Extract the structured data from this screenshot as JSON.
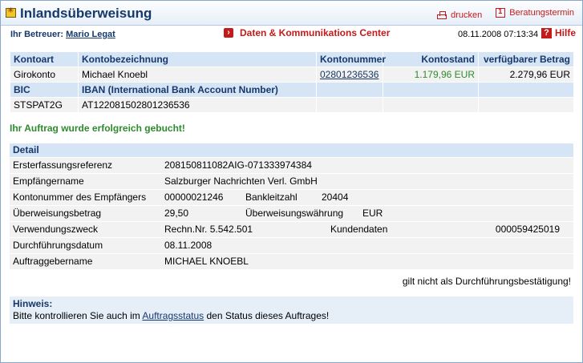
{
  "header": {
    "title": "Inlandsüberweisung",
    "print_label": "drucken",
    "appointment_label": "Beratungstermin"
  },
  "info": {
    "advisor_label": "Ihr Betreuer:",
    "advisor_name": "Mario Legat",
    "center_label": "Daten & Kommunikations Center",
    "datetime": "08.11.2008 07:13:34",
    "help_label": "Hilfe"
  },
  "account": {
    "headers": {
      "kontoart": "Kontoart",
      "bezeichnung": "Kontobezeichnung",
      "nummer": "Kontonummer",
      "stand": "Kontostand",
      "verfuegbar": "verfügbarer Betrag"
    },
    "row": {
      "kontoart": "Girokonto",
      "bezeichnung": "Michael Knoebl",
      "nummer": "02801236536",
      "stand": "1.179,96 EUR",
      "verfuegbar": "2.279,96 EUR"
    },
    "headers2": {
      "bic": "BIC",
      "iban": "IBAN (International Bank Account Number)"
    },
    "row2": {
      "bic": "STSPAT2G",
      "iban": "AT122081502801236536"
    }
  },
  "success_message": "Ihr Auftrag wurde erfolgreich gebucht!",
  "detail": {
    "title": "Detail",
    "ersterfassung_label": "Ersterfassungsreferenz",
    "ersterfassung_value": "208150811082AIG-071333974384",
    "empfaenger_label": "Empfängername",
    "empfaenger_value": "Salzburger Nachrichten Verl. GmbH",
    "kontonr_label": "Kontonummer des Empfängers",
    "kontonr_value": "00000021246",
    "blz_label": "Bankleitzahl",
    "blz_value": "20404",
    "betrag_label": "Überweisungsbetrag",
    "betrag_value": "29,50",
    "waehrung_label": "Überweisungswährung",
    "waehrung_value": "EUR",
    "zweck_label": "Verwendungszweck",
    "zweck_value": "Rechn.Nr. 5.542.501",
    "kunden_label": "Kundendaten",
    "kunden_value": "000059425019",
    "datum_label": "Durchführungsdatum",
    "datum_value": "08.11.2008",
    "auftraggeber_label": "Auftraggebername",
    "auftraggeber_value": "MICHAEL KNOEBL"
  },
  "note": "gilt nicht als Durchführungsbestätigung!",
  "hinweis": {
    "title": "Hinweis:",
    "text_before": "Bitte kontrollieren Sie auch im ",
    "link": "Auftragsstatus",
    "text_after": " den Status dieses Auftrages!"
  }
}
